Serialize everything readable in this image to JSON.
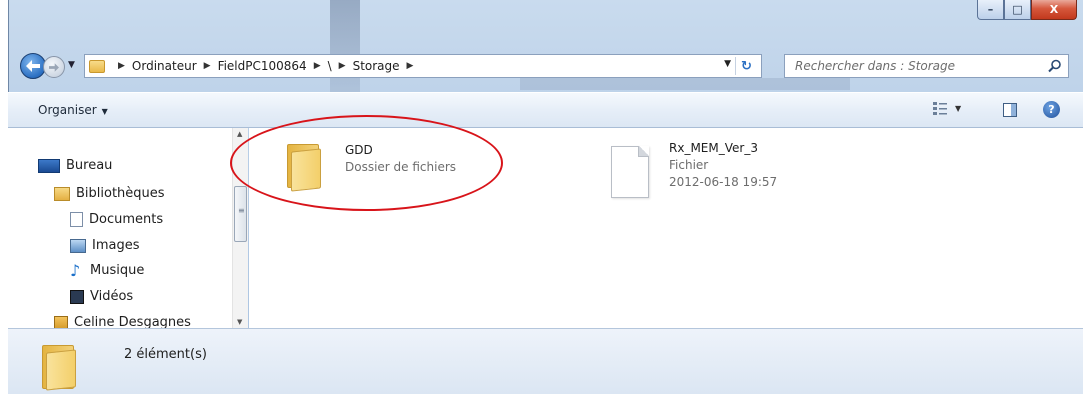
{
  "window": {
    "minimize_glyph": "–",
    "maximize_glyph": "□",
    "close_glyph": "X"
  },
  "address": {
    "crumbs": [
      "Ordinateur",
      "FieldPC100864",
      "\\",
      "Storage"
    ],
    "search_placeholder": "Rechercher dans : Storage"
  },
  "toolbar": {
    "organise_label": "Organiser"
  },
  "nav": {
    "items": [
      {
        "label": "Bureau",
        "icon": "desktop-icon"
      },
      {
        "label": "Bibliothèques",
        "icon": "libraries-icon"
      },
      {
        "label": "Documents",
        "icon": "documents-icon"
      },
      {
        "label": "Images",
        "icon": "pictures-icon"
      },
      {
        "label": "Musique",
        "icon": "music-icon"
      },
      {
        "label": "Vidéos",
        "icon": "videos-icon"
      },
      {
        "label": "Celine Desgagnes",
        "icon": "user-folder-icon"
      }
    ]
  },
  "files": [
    {
      "name": "GDD",
      "type": "Dossier de fichiers",
      "date": "",
      "icon": "folder-icon"
    },
    {
      "name": "Rx_MEM_Ver_3",
      "type": "Fichier",
      "date": "2012-06-18 19:57",
      "icon": "file-icon"
    }
  ],
  "status": {
    "count_text": "2 élément(s)"
  },
  "colors": {
    "annotation_circle": "#d8141a",
    "chrome": "#b7cde6"
  }
}
